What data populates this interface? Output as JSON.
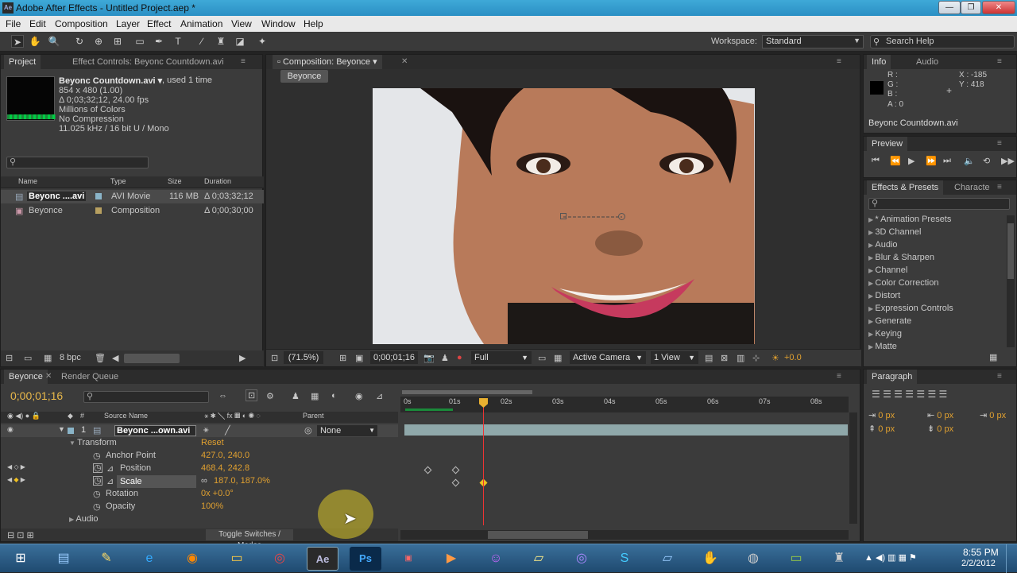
{
  "window": {
    "title": "Adobe After Effects - Untitled Project.aep *",
    "min": "—",
    "max": "❐",
    "close": "✕"
  },
  "menu": [
    "File",
    "Edit",
    "Composition",
    "Layer",
    "Effect",
    "Animation",
    "View",
    "Window",
    "Help"
  ],
  "toolbar": {
    "workspace_label": "Workspace:",
    "workspace_value": "Standard",
    "search_help": "Search Help"
  },
  "project": {
    "tab_project": "Project",
    "tab_effects": "Effect Controls: Beyonc  Countdown.avi",
    "file_name": "Beyonc  Countdown.avi ▾",
    "used": ", used 1 time",
    "info": [
      "854 x 480 (1.00)",
      "Δ 0;03;32;12, 24.00 fps",
      "Millions of Colors",
      "No Compression",
      "11.025 kHz / 16 bit U / Mono"
    ],
    "columns": {
      "name": "Name",
      "type": "Type",
      "size": "Size",
      "duration": "Duration"
    },
    "items": [
      {
        "name": "Beyonc ....avi",
        "type": "AVI Movie",
        "size": "116 MB",
        "duration": "Δ 0;03;32;12"
      },
      {
        "name": "Beyonce",
        "type": "Composition",
        "size": "",
        "duration": "Δ 0;00;30;00"
      }
    ],
    "bpc": "8 bpc"
  },
  "composition": {
    "tab": "Composition: Beyonce",
    "comp_tab": "Beyonce",
    "zoom": "(71.5%)",
    "time": "0;00;01;16",
    "resolution": "Full",
    "camera": "Active Camera",
    "view": "1 View",
    "exposure": "+0.0"
  },
  "info_panel": {
    "tab_info": "Info",
    "tab_audio": "Audio",
    "r": "R :",
    "g": "G :",
    "b": "B :",
    "a": "A : 0",
    "x": "X : -185",
    "y": "Y : 418",
    "file": "Beyonc  Countdown.avi"
  },
  "preview": {
    "tab": "Preview"
  },
  "effects": {
    "tab": "Effects & Presets",
    "tab2": "Characte",
    "items": [
      "* Animation Presets",
      "3D Channel",
      "Audio",
      "Blur & Sharpen",
      "Channel",
      "Color Correction",
      "Distort",
      "Expression Controls",
      "Generate",
      "Keying",
      "Matte"
    ]
  },
  "timeline": {
    "tab": "Beyonce",
    "tab_render": "Render Queue",
    "timecode": "0;00;01;16",
    "col_source": "Source Name",
    "col_parent": "Parent",
    "layer_num": "1",
    "layer_name": "Beyonc ...own.avi",
    "parent_value": "None",
    "transform": "Transform",
    "reset": "Reset",
    "props": [
      {
        "name": "Anchor Point",
        "value": "427.0, 240.0"
      },
      {
        "name": "Position",
        "value": "468.4, 242.8"
      },
      {
        "name": "Scale",
        "value": "187.0, 187.0%"
      },
      {
        "name": "Rotation",
        "value": "0x +0.0°"
      },
      {
        "name": "Opacity",
        "value": "100%"
      }
    ],
    "audio": "Audio",
    "toggle": "Toggle Switches / Modes",
    "ruler": [
      "0s",
      "01s",
      "02s",
      "03s",
      "04s",
      "05s",
      "06s",
      "07s",
      "08s"
    ]
  },
  "paragraph": {
    "tab": "Paragraph",
    "px": "0 px"
  },
  "taskbar": {
    "time": "8:55 PM",
    "date": "2/2/2012"
  }
}
